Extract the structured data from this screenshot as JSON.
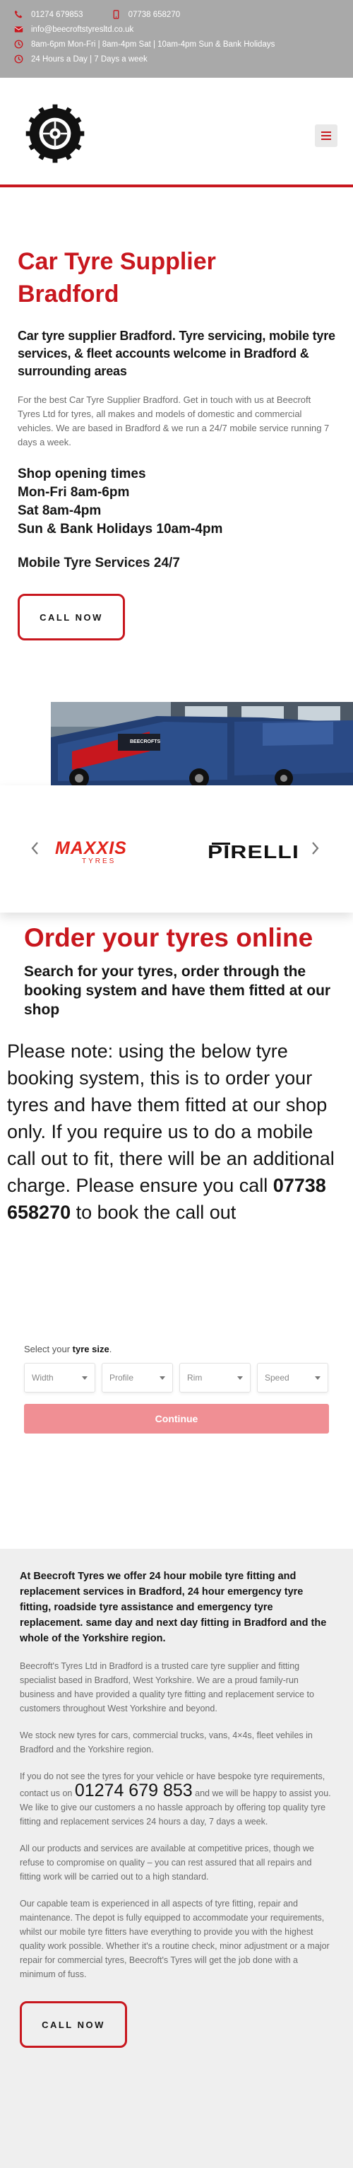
{
  "topbar": {
    "phone1": "01274 679853",
    "phone2": "07738 658270",
    "email": "info@beecroftstyresltd.co.uk",
    "hours_line": "8am-6pm Mon-Fri | 8am-4pm Sat | 10am-4pm Sun & Bank Holidays",
    "availability": "24 Hours a Day | 7 Days a week"
  },
  "header": {
    "menu_icon": "hamburger-icon",
    "accent_color": "#c8171e"
  },
  "hero": {
    "title": "Car Tyre Supplier Bradford",
    "subtitle": "Car tyre supplier Bradford. Tyre servicing, mobile tyre services, & fleet accounts welcome in Bradford & surrounding areas",
    "intro": "For the best Car Tyre Supplier Bradford. Get in touch with us at Beecroft Tyres Ltd for tyres, all makes and models of domestic and commercial vehicles. We are based in Bradford & we run a 24/7 mobile service running 7 days a week.",
    "hours": [
      "Shop opening times",
      "Mon-Fri 8am-6pm",
      "Sat 8am-4pm",
      "Sun & Bank Holidays 10am-4pm"
    ],
    "mobile_services": "Mobile Tyre Services 24/7",
    "call_label": "CALL NOW"
  },
  "brands": {
    "maxxis_name": "MAXXIS",
    "maxxis_sub": "TYRES",
    "pirelli_name": "PIRELLI"
  },
  "order": {
    "title": "Order your tyres online",
    "subtitle": "Search for your tyres, order through the booking system and have them fitted at our shop",
    "note_pre": "Please note: using the below tyre booking system, this is to order your tyres and have them fitted at our shop only. If you require us to do a mobile call out to fit, there will be an additional charge. Please ensure you call ",
    "note_phone": "07738 658270",
    "note_post": " to book the call out"
  },
  "tyre_form": {
    "label_pre": "Select your ",
    "label_bold": "tyre size",
    "label_post": ".",
    "selects": [
      "Width",
      "Profile",
      "Rim",
      "Speed"
    ],
    "continue_label": "Continue"
  },
  "info": {
    "lead": "At Beecroft Tyres we offer 24 hour mobile tyre fitting and replacement services in Bradford, 24 hour emergency tyre fitting, roadside tyre assistance and emergency tyre replacement. same day and next day fitting in Bradford and the whole of the Yorkshire region.",
    "p1": "Beecroft's Tyres Ltd in Bradford is a trusted care tyre supplier and fitting specialist based in Bradford, West Yorkshire. We are a proud family-run business and have provided a quality tyre fitting and replacement service to customers throughout West Yorkshire and beyond.",
    "p2": "We stock new tyres for cars, commercial trucks, vans, 4×4s, fleet vehiles in Bradford and the Yorkshire region.",
    "p3_pre": "If you do not see the tyres for your vehicle or have bespoke tyre requirements, contact us on ",
    "p3_phone": "01274 679 853",
    "p3_post": " and we will be happy to assist you. We like to give our customers a no hassle approach by offering top quality tyre fitting and replacement services 24 hours a day, 7 days a week.",
    "p4": "All our products and services are available at competitive prices, though we refuse to compromise on quality – you can rest assured that all repairs and fitting work will be carried out to a high standard.",
    "p5": "Our capable team is experienced in all aspects of tyre fitting, repair and maintenance. The depot is fully equipped to accommodate your requirements, whilst our mobile tyre fitters have everything to provide you with the highest quality work possible. Whether it's a routine check, minor adjustment or a major repair for commercial tyres, Beecroft's Tyres will get the job done with a minimum of fuss.",
    "call_label": "CALL NOW"
  }
}
